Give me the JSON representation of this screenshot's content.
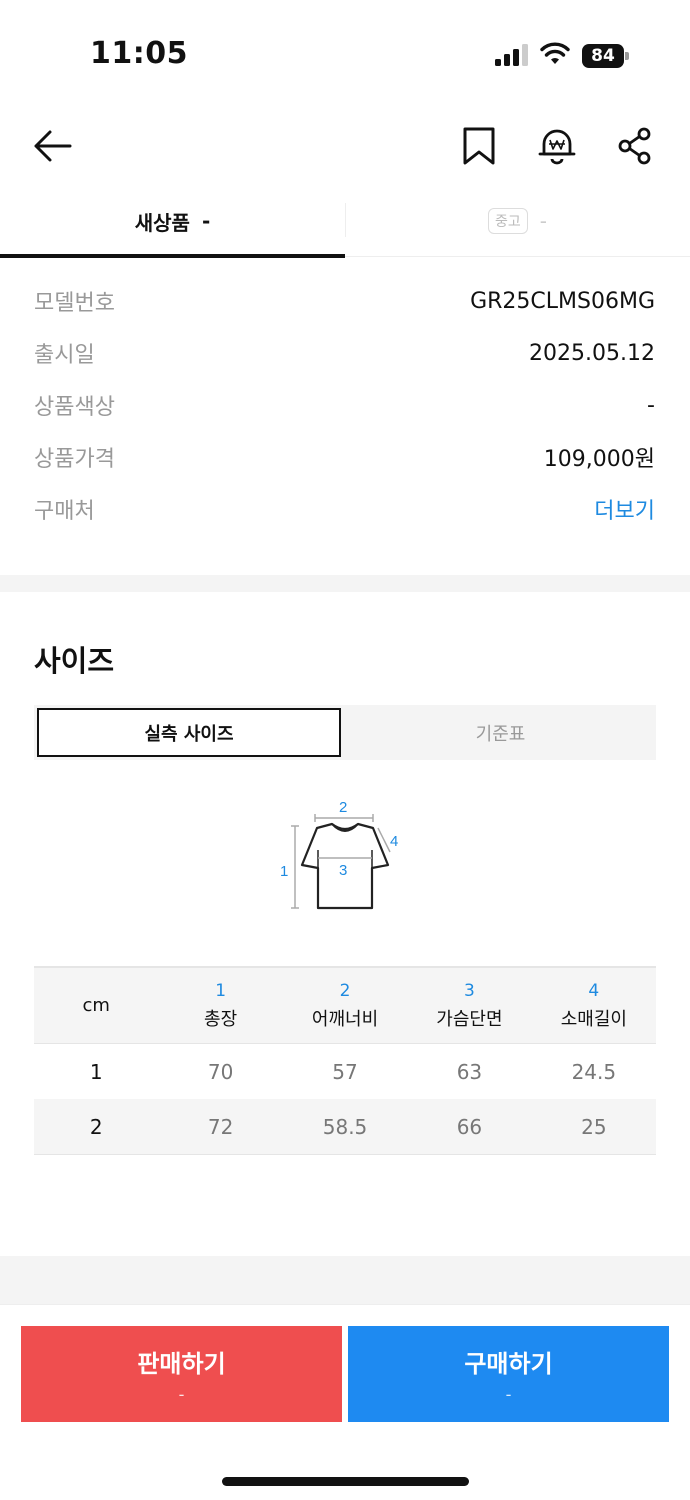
{
  "status": {
    "time": "11:05",
    "battery": "84"
  },
  "tabs": {
    "new_label": "새상품",
    "new_value": "-",
    "used_badge": "중고",
    "used_value": "-"
  },
  "info": [
    {
      "label": "모델번호",
      "value": "GR25CLMS06MG"
    },
    {
      "label": "출시일",
      "value": "2025.05.12"
    },
    {
      "label": "상품색상",
      "value": "-"
    },
    {
      "label": "상품가격",
      "value": "109,000원"
    },
    {
      "label": "구매처",
      "value": "더보기"
    }
  ],
  "size": {
    "title": "사이즈",
    "seg_active": "실측 사이즈",
    "seg_inactive": "기준표",
    "diagram_labels": [
      "1",
      "2",
      "3",
      "4"
    ]
  },
  "size_table": {
    "unit": "cm",
    "columns": [
      {
        "num": "1",
        "name": "총장"
      },
      {
        "num": "2",
        "name": "어깨너비"
      },
      {
        "num": "3",
        "name": "가슴단면"
      },
      {
        "num": "4",
        "name": "소매길이"
      }
    ],
    "rows": [
      {
        "size": "1",
        "values": [
          "70",
          "57",
          "63",
          "24.5"
        ]
      },
      {
        "size": "2",
        "values": [
          "72",
          "58.5",
          "66",
          "25"
        ]
      }
    ]
  },
  "actions": {
    "sell_label": "판매하기",
    "sell_sub": "-",
    "buy_label": "구매하기",
    "buy_sub": "-"
  },
  "colors": {
    "accent_blue": "#1e8af1",
    "sell_red": "#ef4e4f",
    "link_blue": "#1e8ae0"
  }
}
